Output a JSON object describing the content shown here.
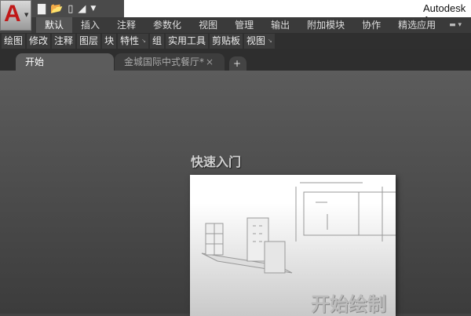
{
  "app": {
    "title": "Autodesk A"
  },
  "quick_access": [
    "new-icon",
    "open-icon",
    "save-icon",
    "plot-icon",
    "dropdown-icon"
  ],
  "ribbon_tabs": [
    "默认",
    "插入",
    "注释",
    "参数化",
    "视图",
    "管理",
    "输出",
    "附加模块",
    "协作",
    "精选应用"
  ],
  "panels": [
    {
      "label": "绘图"
    },
    {
      "label": "修改"
    },
    {
      "label": "注释"
    },
    {
      "label": "图层"
    },
    {
      "label": "块"
    },
    {
      "label": "特性",
      "expand": true
    },
    {
      "label": "组"
    },
    {
      "label": "实用工具"
    },
    {
      "label": "剪贴板"
    },
    {
      "label": "视图",
      "expand": true
    }
  ],
  "file_tabs": {
    "start": "开始",
    "drawing": "金城国际中式餐厅*",
    "close": "×",
    "add": "+"
  },
  "start_page": {
    "heading": "快速入门",
    "card_label": "开始绘制"
  }
}
